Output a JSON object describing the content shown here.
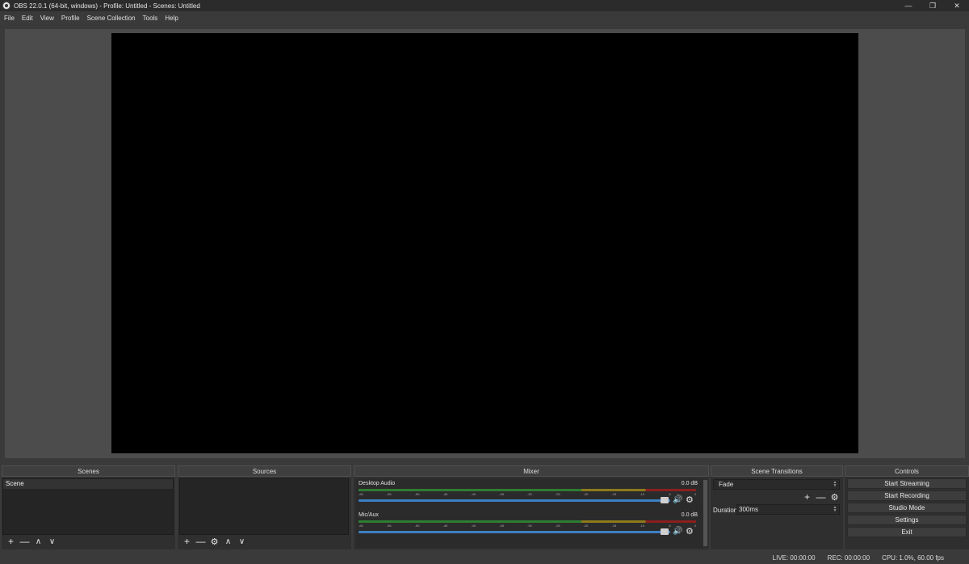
{
  "window": {
    "title": "OBS 22.0.1 (64-bit, windows) - Profile: Untitled - Scenes: Untitled",
    "minimize": "—",
    "restore": "❐",
    "close": "✕"
  },
  "menu": {
    "file": "File",
    "edit": "Edit",
    "view": "View",
    "profile": "Profile",
    "scene_collection": "Scene Collection",
    "tools": "Tools",
    "help": "Help"
  },
  "scenes": {
    "header": "Scenes",
    "items": [
      "Scene"
    ],
    "add": "+",
    "remove": "—",
    "up": "∧",
    "down": "∨"
  },
  "sources": {
    "header": "Sources",
    "add": "+",
    "remove": "—",
    "settings": "⚙",
    "up": "∧",
    "down": "∨"
  },
  "mixer": {
    "header": "Mixer",
    "ticks": [
      "-60",
      "-55",
      "-50",
      "-45",
      "-40",
      "-35",
      "-30",
      "-25",
      "-20",
      "-15",
      "-10",
      "-5",
      "0"
    ],
    "channels": [
      {
        "name": "Desktop Audio",
        "db": "0.0 dB",
        "volume_fraction": 1.0
      },
      {
        "name": "Mic/Aux",
        "db": "0.0 dB",
        "volume_fraction": 1.0
      }
    ],
    "volume_icon": "🔊",
    "gear_icon": "⚙"
  },
  "transitions": {
    "header": "Scene Transitions",
    "selected": "Fade",
    "add": "+",
    "remove": "—",
    "settings": "⚙",
    "duration_label": "Duration",
    "duration_value": "300ms"
  },
  "controls": {
    "header": "Controls",
    "start_streaming": "Start Streaming",
    "start_recording": "Start Recording",
    "studio_mode": "Studio Mode",
    "settings": "Settings",
    "exit": "Exit"
  },
  "status": {
    "live": "LIVE: 00:00:00",
    "rec": "REC: 00:00:00",
    "cpu": "CPU: 1.0%, 60.00 fps"
  }
}
